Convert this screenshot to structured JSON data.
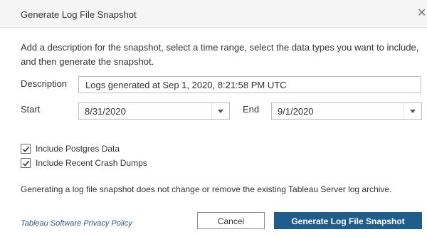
{
  "dialog": {
    "title": "Generate Log File Snapshot",
    "close_glyph": "✕"
  },
  "intro_text": "Add a description for the snapshot, select a time range, select the data types you want to include, and then generate the snapshot.",
  "description": {
    "label": "Description",
    "value": "Logs generated at Sep 1, 2020, 8:21:58 PM UTC"
  },
  "start": {
    "label": "Start",
    "value": "8/31/2020"
  },
  "end": {
    "label": "End",
    "value": "9/1/2020"
  },
  "options": [
    {
      "label": "Include Postgres Data",
      "checked": true
    },
    {
      "label": "Include Recent Crash Dumps",
      "checked": true
    }
  ],
  "note": "Generating a log file snapshot does not change or remove the existing Tableau Server log archive.",
  "footer": {
    "privacy_link": "Tableau Software Privacy Policy",
    "cancel_label": "Cancel",
    "generate_label": "Generate Log File Snapshot"
  },
  "colors": {
    "primary": "#1f5e8c",
    "link": "#2b5b87",
    "header_bg": "#f5f5f5"
  },
  "icons": {
    "close": "close-icon",
    "dropdown": "chevron-down-icon",
    "check": "checkmark-icon"
  }
}
